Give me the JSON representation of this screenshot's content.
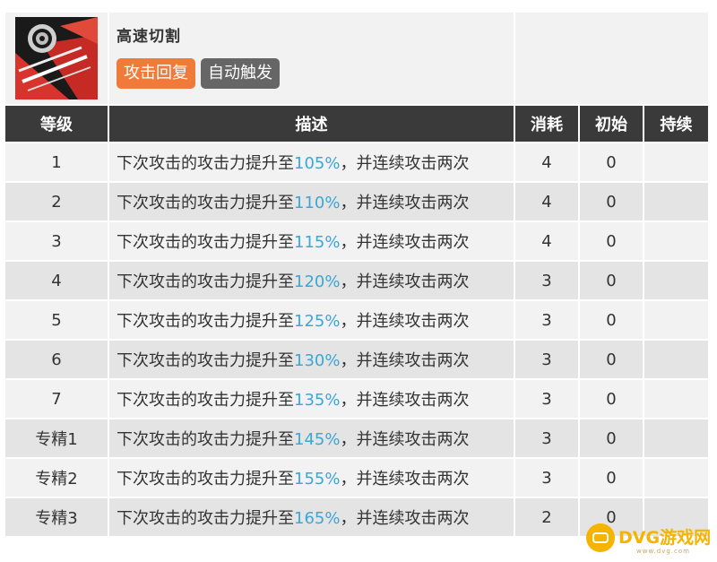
{
  "skill": {
    "name": "高速切割",
    "icon": "skill-saw-blade-icon",
    "tags": [
      {
        "label": "攻击回复",
        "color": "#f07a3a"
      },
      {
        "label": "自动触发",
        "color": "#666666"
      }
    ]
  },
  "table": {
    "headers": {
      "level": "等级",
      "description": "描述",
      "cost": "消耗",
      "initial": "初始",
      "duration": "持续"
    },
    "rows": [
      {
        "level": "1",
        "desc_prefix": "下次攻击的攻击力提升至",
        "percent": "105%",
        "desc_suffix": "，并连续攻击两次",
        "cost": "4",
        "initial": "0",
        "duration": ""
      },
      {
        "level": "2",
        "desc_prefix": "下次攻击的攻击力提升至",
        "percent": "110%",
        "desc_suffix": "，并连续攻击两次",
        "cost": "4",
        "initial": "0",
        "duration": ""
      },
      {
        "level": "3",
        "desc_prefix": "下次攻击的攻击力提升至",
        "percent": "115%",
        "desc_suffix": "，并连续攻击两次",
        "cost": "4",
        "initial": "0",
        "duration": ""
      },
      {
        "level": "4",
        "desc_prefix": "下次攻击的攻击力提升至",
        "percent": "120%",
        "desc_suffix": "，并连续攻击两次",
        "cost": "3",
        "initial": "0",
        "duration": ""
      },
      {
        "level": "5",
        "desc_prefix": "下次攻击的攻击力提升至",
        "percent": "125%",
        "desc_suffix": "，并连续攻击两次",
        "cost": "3",
        "initial": "0",
        "duration": ""
      },
      {
        "level": "6",
        "desc_prefix": "下次攻击的攻击力提升至",
        "percent": "130%",
        "desc_suffix": "，并连续攻击两次",
        "cost": "3",
        "initial": "0",
        "duration": ""
      },
      {
        "level": "7",
        "desc_prefix": "下次攻击的攻击力提升至",
        "percent": "135%",
        "desc_suffix": "，并连续攻击两次",
        "cost": "3",
        "initial": "0",
        "duration": ""
      },
      {
        "level": "专精1",
        "desc_prefix": "下次攻击的攻击力提升至",
        "percent": "145%",
        "desc_suffix": "，并连续攻击两次",
        "cost": "3",
        "initial": "0",
        "duration": ""
      },
      {
        "level": "专精2",
        "desc_prefix": "下次攻击的攻击力提升至",
        "percent": "155%",
        "desc_suffix": "，并连续攻击两次",
        "cost": "3",
        "initial": "0",
        "duration": ""
      },
      {
        "level": "专精3",
        "desc_prefix": "下次攻击的攻击力提升至",
        "percent": "165%",
        "desc_suffix": "，并连续攻击两次",
        "cost": "2",
        "initial": "0",
        "duration": ""
      }
    ]
  },
  "colors": {
    "header_bg": "#3a3a3a",
    "row_light": "#f2f2f2",
    "row_dark": "#e4e4e4",
    "percent_accent": "#3aa7d8"
  },
  "watermark": {
    "brand": "DVG游戏网",
    "sub": "www.dvg.com",
    "logo_icon": "dvg-logo-icon"
  }
}
